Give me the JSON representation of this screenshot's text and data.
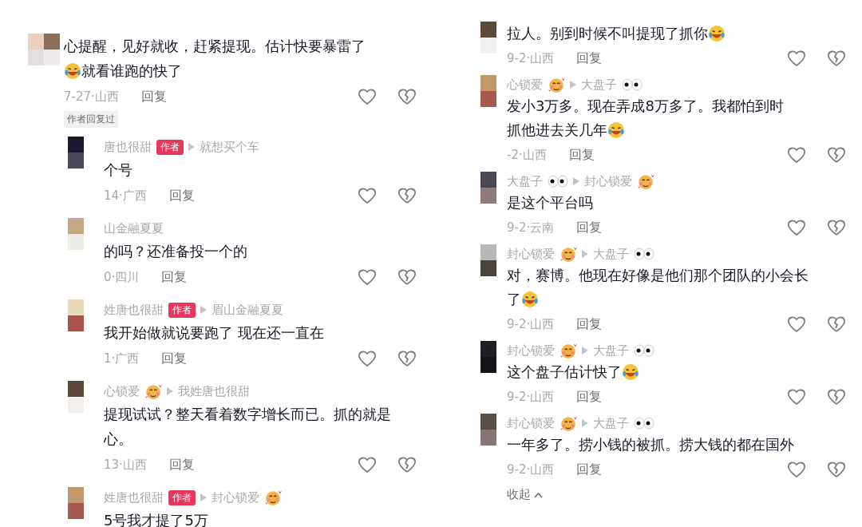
{
  "left_thread": {
    "comment": {
      "lines": [
        [
          {
            "kind": "text",
            "text": "心提醒，见好就收，赶紧提现。估计快要暴雷了"
          }
        ],
        [
          {
            "kind": "tears"
          },
          {
            "kind": "text",
            "text": "就看谁跑的快了"
          }
        ]
      ],
      "meta": "7-27·山西",
      "reply": "回复",
      "badge": "作者回复过"
    },
    "replies": [
      {
        "user": [
          {
            "kind": "text",
            "text": "唐也很甜"
          }
        ],
        "author_tag": "作者",
        "reply_to": [
          {
            "kind": "text",
            "text": "就想买个车"
          }
        ],
        "lines": [
          [
            {
              "kind": "text",
              "text": "个号"
            }
          ]
        ],
        "meta": "14·广西",
        "reply": "回复"
      },
      {
        "user": [
          {
            "kind": "text",
            "text": "山金融夏夏"
          }
        ],
        "lines": [
          [
            {
              "kind": "text",
              "text": "的吗？还准备投一个的"
            }
          ]
        ],
        "meta": "0·四川",
        "reply": "回复"
      },
      {
        "user": [
          {
            "kind": "text",
            "text": "姓唐也很甜"
          }
        ],
        "author_tag": "作者",
        "reply_to": [
          {
            "kind": "text",
            "text": "眉山金融夏夏"
          }
        ],
        "lines": [
          [
            {
              "kind": "text",
              "text": "我开始做就说要跑了 现在还一直在"
            }
          ]
        ],
        "meta": "1·广西",
        "reply": "回复"
      },
      {
        "user": [
          {
            "kind": "text",
            "text": "心锁爱"
          },
          {
            "kind": "hearts"
          }
        ],
        "reply_to": [
          {
            "kind": "text",
            "text": "我姓唐也很甜"
          }
        ],
        "lines": [
          [
            {
              "kind": "text",
              "text": "提现试试？整天看着数字增长而已。抓的就是"
            }
          ],
          [
            {
              "kind": "text",
              "text": "心。"
            }
          ]
        ],
        "meta": "13·山西",
        "reply": "回复"
      },
      {
        "user": [
          {
            "kind": "text",
            "text": "姓唐也很甜"
          }
        ],
        "author_tag": "作者",
        "reply_to": [
          {
            "kind": "text",
            "text": "封心锁爱"
          },
          {
            "kind": "hearts"
          }
        ],
        "lines": [
          [
            {
              "kind": "text",
              "text": "5号我才提了5万"
            }
          ]
        ]
      }
    ]
  },
  "right_thread": {
    "replies": [
      {
        "lines": [
          [
            {
              "kind": "text",
              "text": "拉人。别到时候不叫提现了抓你"
            },
            {
              "kind": "tears"
            }
          ]
        ],
        "meta": "9-2·山西",
        "reply": "回复"
      },
      {
        "user": [
          {
            "kind": "text",
            "text": "心锁爱"
          },
          {
            "kind": "hearts"
          }
        ],
        "reply_to": [
          {
            "kind": "text",
            "text": "大盘子"
          },
          {
            "kind": "eyes"
          }
        ],
        "lines": [
          [
            {
              "kind": "text",
              "text": "发小3万多。现在弄成8万多了。我都怕到时"
            }
          ],
          [
            {
              "kind": "text",
              "text": "抓他进去关几年"
            },
            {
              "kind": "tears"
            }
          ]
        ],
        "meta": "-2·山西",
        "reply": "回复"
      },
      {
        "user": [
          {
            "kind": "text",
            "text": "大盘子"
          },
          {
            "kind": "eyes"
          }
        ],
        "reply_to": [
          {
            "kind": "text",
            "text": "封心锁爱"
          },
          {
            "kind": "hearts"
          }
        ],
        "lines": [
          [
            {
              "kind": "text",
              "text": "是这个平台吗"
            }
          ]
        ],
        "meta": "9-2·云南",
        "reply": "回复"
      },
      {
        "user": [
          {
            "kind": "text",
            "text": "封心锁爱"
          },
          {
            "kind": "hearts"
          }
        ],
        "reply_to": [
          {
            "kind": "text",
            "text": "大盘子"
          },
          {
            "kind": "eyes"
          }
        ],
        "lines": [
          [
            {
              "kind": "text",
              "text": "对，赛博。他现在好像是他们那个团队的小会长"
            }
          ],
          [
            {
              "kind": "text",
              "text": "了"
            },
            {
              "kind": "tears"
            }
          ]
        ],
        "meta": "9-2·山西",
        "reply": "回复"
      },
      {
        "user": [
          {
            "kind": "text",
            "text": "封心锁爱"
          },
          {
            "kind": "hearts"
          }
        ],
        "reply_to": [
          {
            "kind": "text",
            "text": "大盘子"
          },
          {
            "kind": "eyes"
          }
        ],
        "lines": [
          [
            {
              "kind": "text",
              "text": "这个盘子估计快了"
            },
            {
              "kind": "tears"
            }
          ]
        ],
        "meta": "9-2·山西",
        "reply": "回复"
      },
      {
        "user": [
          {
            "kind": "text",
            "text": "封心锁爱"
          },
          {
            "kind": "hearts"
          }
        ],
        "reply_to": [
          {
            "kind": "text",
            "text": "大盘子"
          },
          {
            "kind": "eyes"
          }
        ],
        "lines": [
          [
            {
              "kind": "text",
              "text": "一年多了。捞小钱的被抓。捞大钱的都在国外"
            }
          ]
        ],
        "meta": "9-2·山西",
        "reply": "回复"
      }
    ],
    "collapse": "收起"
  }
}
